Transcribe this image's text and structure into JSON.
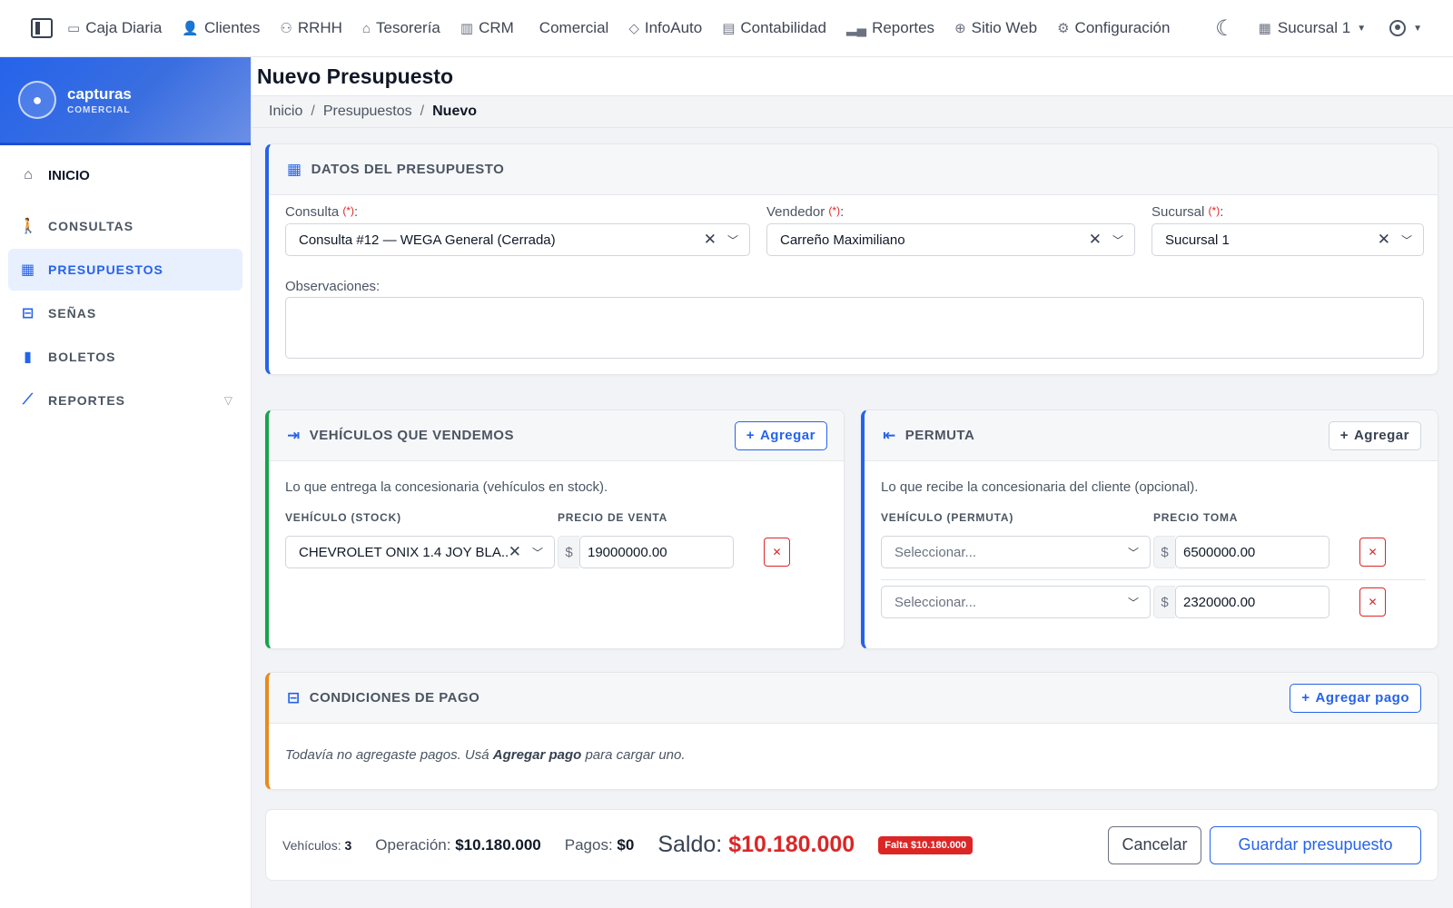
{
  "topnav": {
    "items": [
      {
        "label": "Caja Diaria",
        "icon": "cash-icon"
      },
      {
        "label": "Clientes",
        "icon": "clients-icon"
      },
      {
        "label": "RRHH",
        "icon": "people-icon"
      },
      {
        "label": "Tesorería",
        "icon": "bank-icon"
      },
      {
        "label": "CRM",
        "icon": "kanban-icon"
      },
      {
        "label": "Comercial",
        "icon": "car-icon"
      },
      {
        "label": "InfoAuto",
        "icon": "tag-icon"
      },
      {
        "label": "Contabilidad",
        "icon": "ledger-icon"
      },
      {
        "label": "Reportes",
        "icon": "bar-chart-icon"
      },
      {
        "label": "Sitio Web",
        "icon": "globe-icon"
      },
      {
        "label": "Configuración",
        "icon": "gear-icon"
      }
    ],
    "branch": "Sucursal 1"
  },
  "sidebar": {
    "brand_name": "capturas",
    "brand_sub": "COMERCIAL",
    "items": [
      {
        "label": "INICIO",
        "icon": "home-icon"
      },
      {
        "label": "CONSULTAS",
        "icon": "person-walking-icon"
      },
      {
        "label": "PRESUPUESTOS",
        "icon": "calculator-icon"
      },
      {
        "label": "SEÑAS",
        "icon": "deposit-icon"
      },
      {
        "label": "BOLETOS",
        "icon": "document-check-icon"
      },
      {
        "label": "REPORTES",
        "icon": "line-chart-icon"
      }
    ]
  },
  "page": {
    "title": "Nuevo Presupuesto",
    "breadcrumb": [
      "Inicio",
      "Presupuestos",
      "Nuevo"
    ]
  },
  "datos": {
    "header": "DATOS DEL PRESUPUESTO",
    "consulta_label": "Consulta",
    "consulta_value": "Consulta #12 — WEGA General (Cerrada)",
    "vendedor_label": "Vendedor",
    "vendedor_value": "Carreño Maximiliano",
    "sucursal_label": "Sucursal",
    "sucursal_value": "Sucursal 1",
    "required_mark": "(*)",
    "observaciones_label": "Observaciones:",
    "observaciones_value": ""
  },
  "vendemos": {
    "header": "VEHÍCULOS QUE VENDEMOS",
    "add_label": "Agregar",
    "hint": "Lo que entrega la concesionaria (vehículos en stock).",
    "col_vehicle": "VEHÍCULO (STOCK)",
    "col_price": "PRECIO DE VENTA",
    "rows": [
      {
        "vehicle": "CHEVROLET ONIX 1.4 JOY BLA...",
        "price": "19000000.00"
      }
    ]
  },
  "permuta": {
    "header": "PERMUTA",
    "add_label": "Agregar",
    "hint": "Lo que recibe la concesionaria del cliente (opcional).",
    "col_vehicle": "VEHÍCULO (PERMUTA)",
    "col_price": "PRECIO TOMA",
    "rows": [
      {
        "vehicle": "Seleccionar...",
        "price": "6500000.00"
      },
      {
        "vehicle": "Seleccionar...",
        "price": "2320000.00"
      }
    ]
  },
  "pago": {
    "header": "CONDICIONES DE PAGO",
    "add_label": "Agregar pago",
    "empty_pre": "Todavía no agregaste pagos. Usá ",
    "empty_bold": "Agregar pago",
    "empty_post": " para cargar uno."
  },
  "summary": {
    "vehiculos_label": "Vehículos:",
    "vehiculos_value": "3",
    "operacion_label": "Operación:",
    "operacion_value": "$10.180.000",
    "pagos_label": "Pagos:",
    "pagos_value": "$0",
    "saldo_label": "Saldo:",
    "saldo_value": "$10.180.000",
    "badge": "Falta $10.180.000",
    "cancel_label": "Cancelar",
    "save_label": "Guardar presupuesto"
  },
  "currency_symbol": "$",
  "colors": {
    "accent": "#2563eb",
    "danger": "#dc2626",
    "success": "#16a34a",
    "warning": "#ea8a1a"
  }
}
